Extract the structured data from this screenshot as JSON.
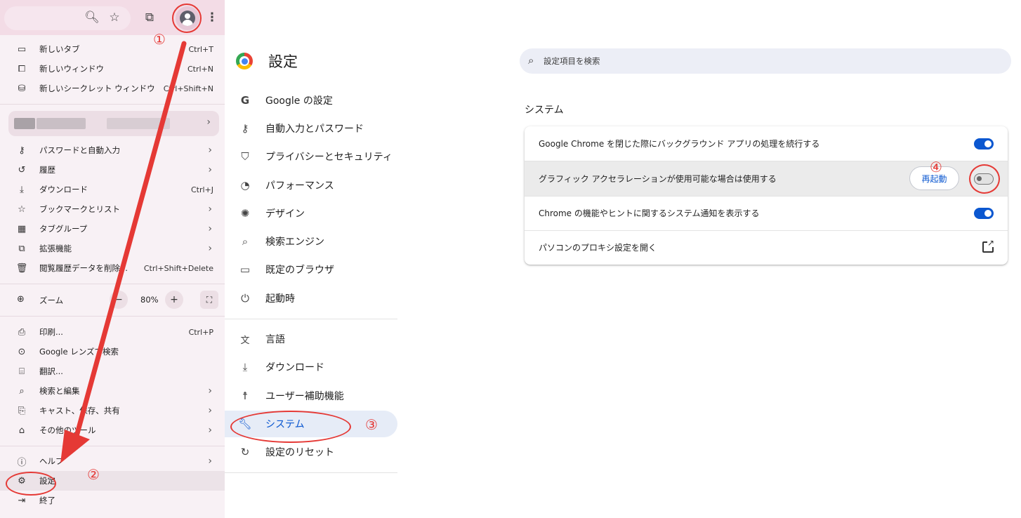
{
  "menu": {
    "items_top": [
      {
        "icon": "new-tab-icon",
        "label": "新しいタブ",
        "shortcut": "Ctrl+T"
      },
      {
        "icon": "new-window-icon",
        "label": "新しいウィンドウ",
        "shortcut": "Ctrl+N"
      },
      {
        "icon": "incognito-icon",
        "label": "新しいシークレット ウィンドウ",
        "shortcut": "Ctrl+Shift+N"
      }
    ],
    "items_mid": [
      {
        "icon": "key-icon",
        "label": "パスワードと自動入力"
      },
      {
        "icon": "history-icon",
        "label": "履歴"
      },
      {
        "icon": "download-icon",
        "label": "ダウンロード",
        "shortcut": "Ctrl+J"
      },
      {
        "icon": "star-icon",
        "label": "ブックマークとリスト"
      },
      {
        "icon": "tab-groups-icon",
        "label": "タブグループ"
      },
      {
        "icon": "extension-icon",
        "label": "拡張機能"
      },
      {
        "icon": "trash-icon",
        "label": "閲覧履歴データを削除...",
        "shortcut": "Ctrl+Shift+Delete"
      }
    ],
    "zoom": {
      "label": "ズーム",
      "minus": "−",
      "value": "80%",
      "plus": "+"
    },
    "items_bottom": [
      {
        "icon": "print-icon",
        "label": "印刷...",
        "shortcut": "Ctrl+P"
      },
      {
        "icon": "google-lens-icon",
        "label": "Google レンズで検索"
      },
      {
        "icon": "translate-icon",
        "label": "翻訳..."
      },
      {
        "icon": "search-edit-icon",
        "label": "検索と編集"
      },
      {
        "icon": "cast-icon",
        "label": "キャスト、保存、共有"
      },
      {
        "icon": "more-tools-icon",
        "label": "その他のツール"
      }
    ],
    "items_last": [
      {
        "icon": "help-icon",
        "label": "ヘルプ"
      },
      {
        "icon": "gear-icon",
        "label": "設定"
      },
      {
        "icon": "exit-icon",
        "label": "終了"
      }
    ]
  },
  "settings": {
    "title": "設定",
    "search_placeholder": "設定項目を検索",
    "nav": [
      {
        "icon": "google-icon",
        "label": "Google の設定"
      },
      {
        "icon": "key-icon",
        "label": "自動入力とパスワード"
      },
      {
        "icon": "shield-icon",
        "label": "プライバシーとセキュリティ"
      },
      {
        "icon": "speedometer-icon",
        "label": "パフォーマンス"
      },
      {
        "icon": "palette-icon",
        "label": "デザイン"
      },
      {
        "icon": "search-icon",
        "label": "検索エンジン"
      },
      {
        "icon": "browser-icon",
        "label": "既定のブラウザ"
      },
      {
        "icon": "power-icon",
        "label": "起動時"
      },
      {
        "icon": "language-icon",
        "label": "言語"
      },
      {
        "icon": "download-icon",
        "label": "ダウンロード"
      },
      {
        "icon": "accessibility-icon",
        "label": "ユーザー補助機能"
      },
      {
        "icon": "wrench-icon",
        "label": "システム",
        "active": true
      },
      {
        "icon": "reset-icon",
        "label": "設定のリセット"
      }
    ],
    "section_title": "システム",
    "rows": [
      {
        "label": "Google Chrome を閉じた際にバックグラウンド アプリの処理を続行する",
        "toggle": "on"
      },
      {
        "label": "グラフィック アクセラレーションが使用可能な場合は使用する",
        "toggle": "off",
        "button": "再起動"
      },
      {
        "label": "Chrome の機能やヒントに関するシステム通知を表示する",
        "toggle": "on"
      },
      {
        "label": "パソコンのプロキシ設定を開く",
        "external_link": true
      }
    ]
  },
  "annotations": {
    "step1": "①",
    "step2": "②",
    "step3": "③",
    "step4": "④",
    "color": "#e53935"
  }
}
